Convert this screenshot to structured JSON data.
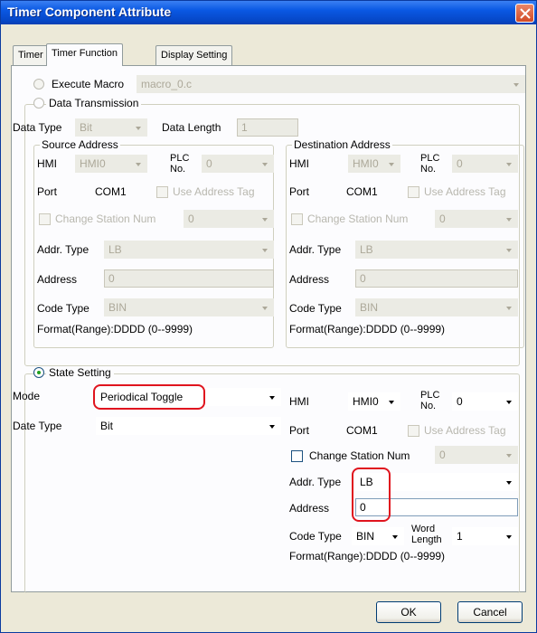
{
  "window": {
    "title": "Timer Component Attribute"
  },
  "tabs": [
    {
      "label": "Timer"
    },
    {
      "label": "Timer Function"
    },
    {
      "label": "Display Setting"
    }
  ],
  "execute_macro": {
    "label": "Execute Macro",
    "value": "macro_0.c"
  },
  "data_transmission": {
    "label": "Data Transmission",
    "data_type_label": "Data Type",
    "data_type_value": "Bit",
    "data_length_label": "Data Length",
    "data_length_value": "1",
    "source": {
      "title": "Source Address",
      "hmi_label": "HMI",
      "hmi_value": "HMI0",
      "plc_no_label_1": "PLC",
      "plc_no_label_2": "No.",
      "plc_no_value": "0",
      "port_label": "Port",
      "port_value": "COM1",
      "use_address_tag": "Use Address Tag",
      "change_station": "Change Station Num",
      "station_value": "0",
      "addr_type_label": "Addr. Type",
      "addr_type_value": "LB",
      "address_label": "Address",
      "address_value": "0",
      "code_type_label": "Code Type",
      "code_type_value": "BIN",
      "format": "Format(Range):DDDD (0--9999)"
    },
    "destination": {
      "title": "Destination Address",
      "hmi_label": "HMI",
      "hmi_value": "HMI0",
      "plc_no_label_1": "PLC",
      "plc_no_label_2": "No.",
      "plc_no_value": "0",
      "port_label": "Port",
      "port_value": "COM1",
      "use_address_tag": "Use Address Tag",
      "change_station": "Change Station Num",
      "station_value": "0",
      "addr_type_label": "Addr. Type",
      "addr_type_value": "LB",
      "address_label": "Address",
      "address_value": "0",
      "code_type_label": "Code Type",
      "code_type_value": "BIN",
      "format": "Format(Range):DDDD (0--9999)"
    }
  },
  "state_setting": {
    "label": "State Setting",
    "mode_label": "Mode",
    "mode_value": "Periodical Toggle",
    "date_type_label": "Date Type",
    "date_type_value": "Bit",
    "hmi_label": "HMI",
    "hmi_value": "HMI0",
    "plc_no_label_1": "PLC",
    "plc_no_label_2": "No.",
    "plc_no_value": "0",
    "port_label": "Port",
    "port_value": "COM1",
    "use_address_tag": "Use Address Tag",
    "change_station": "Change Station Num",
    "station_value": "0",
    "addr_type_label": "Addr. Type",
    "addr_type_value": "LB",
    "address_label": "Address",
    "address_value": "0",
    "code_type_label": "Code Type",
    "code_type_value": "BIN",
    "word_length_label_1": "Word",
    "word_length_label_2": "Length",
    "word_length_value": "1",
    "format": "Format(Range):DDDD (0--9999)"
  },
  "buttons": {
    "ok": "OK",
    "cancel": "Cancel"
  },
  "colors": {
    "title_bar": "#0a58e3",
    "highlight": "#e0141e",
    "radio_dot": "#21a121"
  }
}
